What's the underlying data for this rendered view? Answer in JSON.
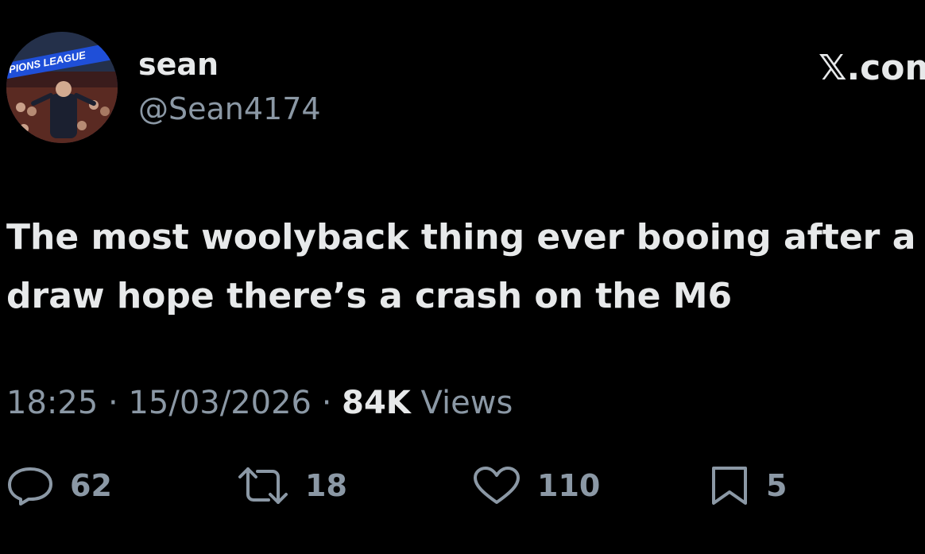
{
  "author": {
    "display_name": "sean",
    "handle": "@Sean4174",
    "avatar_banner_text": "PIONS LEAGUE"
  },
  "watermark": "𝕏.com",
  "tweet": {
    "text": "The most woolyback thing ever booing after a\ndraw hope there’s a crash on the M6"
  },
  "meta": {
    "time": "18:25",
    "separator": "·",
    "date": "15/03/2026",
    "views_count": "84K",
    "views_label": "Views"
  },
  "actions": {
    "replies": "62",
    "reposts": "18",
    "likes": "110",
    "bookmarks": "5"
  },
  "colors": {
    "background": "#000000",
    "primary_text": "#e7e9ea",
    "secondary_text": "#8b98a5"
  },
  "icons": [
    "reply-icon",
    "repost-icon",
    "like-icon",
    "bookmark-icon"
  ]
}
